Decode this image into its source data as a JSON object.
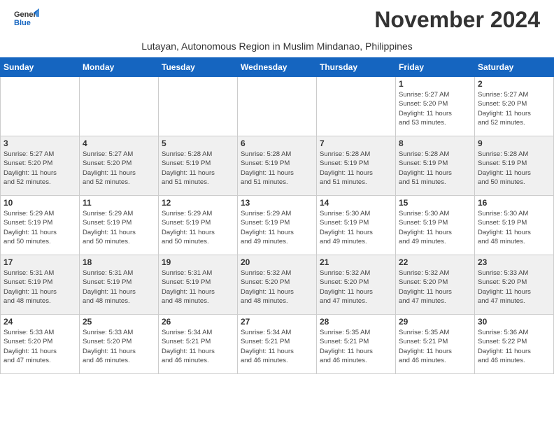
{
  "header": {
    "logo": {
      "text_general": "General",
      "text_blue": "Blue"
    },
    "month_title": "November 2024",
    "subtitle": "Lutayan, Autonomous Region in Muslim Mindanao, Philippines"
  },
  "calendar": {
    "days_of_week": [
      "Sunday",
      "Monday",
      "Tuesday",
      "Wednesday",
      "Thursday",
      "Friday",
      "Saturday"
    ],
    "weeks": [
      {
        "days": [
          {
            "num": "",
            "info": ""
          },
          {
            "num": "",
            "info": ""
          },
          {
            "num": "",
            "info": ""
          },
          {
            "num": "",
            "info": ""
          },
          {
            "num": "",
            "info": ""
          },
          {
            "num": "1",
            "info": "Sunrise: 5:27 AM\nSunset: 5:20 PM\nDaylight: 11 hours\nand 53 minutes."
          },
          {
            "num": "2",
            "info": "Sunrise: 5:27 AM\nSunset: 5:20 PM\nDaylight: 11 hours\nand 52 minutes."
          }
        ]
      },
      {
        "days": [
          {
            "num": "3",
            "info": "Sunrise: 5:27 AM\nSunset: 5:20 PM\nDaylight: 11 hours\nand 52 minutes."
          },
          {
            "num": "4",
            "info": "Sunrise: 5:27 AM\nSunset: 5:20 PM\nDaylight: 11 hours\nand 52 minutes."
          },
          {
            "num": "5",
            "info": "Sunrise: 5:28 AM\nSunset: 5:19 PM\nDaylight: 11 hours\nand 51 minutes."
          },
          {
            "num": "6",
            "info": "Sunrise: 5:28 AM\nSunset: 5:19 PM\nDaylight: 11 hours\nand 51 minutes."
          },
          {
            "num": "7",
            "info": "Sunrise: 5:28 AM\nSunset: 5:19 PM\nDaylight: 11 hours\nand 51 minutes."
          },
          {
            "num": "8",
            "info": "Sunrise: 5:28 AM\nSunset: 5:19 PM\nDaylight: 11 hours\nand 51 minutes."
          },
          {
            "num": "9",
            "info": "Sunrise: 5:28 AM\nSunset: 5:19 PM\nDaylight: 11 hours\nand 50 minutes."
          }
        ]
      },
      {
        "days": [
          {
            "num": "10",
            "info": "Sunrise: 5:29 AM\nSunset: 5:19 PM\nDaylight: 11 hours\nand 50 minutes."
          },
          {
            "num": "11",
            "info": "Sunrise: 5:29 AM\nSunset: 5:19 PM\nDaylight: 11 hours\nand 50 minutes."
          },
          {
            "num": "12",
            "info": "Sunrise: 5:29 AM\nSunset: 5:19 PM\nDaylight: 11 hours\nand 50 minutes."
          },
          {
            "num": "13",
            "info": "Sunrise: 5:29 AM\nSunset: 5:19 PM\nDaylight: 11 hours\nand 49 minutes."
          },
          {
            "num": "14",
            "info": "Sunrise: 5:30 AM\nSunset: 5:19 PM\nDaylight: 11 hours\nand 49 minutes."
          },
          {
            "num": "15",
            "info": "Sunrise: 5:30 AM\nSunset: 5:19 PM\nDaylight: 11 hours\nand 49 minutes."
          },
          {
            "num": "16",
            "info": "Sunrise: 5:30 AM\nSunset: 5:19 PM\nDaylight: 11 hours\nand 48 minutes."
          }
        ]
      },
      {
        "days": [
          {
            "num": "17",
            "info": "Sunrise: 5:31 AM\nSunset: 5:19 PM\nDaylight: 11 hours\nand 48 minutes."
          },
          {
            "num": "18",
            "info": "Sunrise: 5:31 AM\nSunset: 5:19 PM\nDaylight: 11 hours\nand 48 minutes."
          },
          {
            "num": "19",
            "info": "Sunrise: 5:31 AM\nSunset: 5:19 PM\nDaylight: 11 hours\nand 48 minutes."
          },
          {
            "num": "20",
            "info": "Sunrise: 5:32 AM\nSunset: 5:20 PM\nDaylight: 11 hours\nand 48 minutes."
          },
          {
            "num": "21",
            "info": "Sunrise: 5:32 AM\nSunset: 5:20 PM\nDaylight: 11 hours\nand 47 minutes."
          },
          {
            "num": "22",
            "info": "Sunrise: 5:32 AM\nSunset: 5:20 PM\nDaylight: 11 hours\nand 47 minutes."
          },
          {
            "num": "23",
            "info": "Sunrise: 5:33 AM\nSunset: 5:20 PM\nDaylight: 11 hours\nand 47 minutes."
          }
        ]
      },
      {
        "days": [
          {
            "num": "24",
            "info": "Sunrise: 5:33 AM\nSunset: 5:20 PM\nDaylight: 11 hours\nand 47 minutes."
          },
          {
            "num": "25",
            "info": "Sunrise: 5:33 AM\nSunset: 5:20 PM\nDaylight: 11 hours\nand 46 minutes."
          },
          {
            "num": "26",
            "info": "Sunrise: 5:34 AM\nSunset: 5:21 PM\nDaylight: 11 hours\nand 46 minutes."
          },
          {
            "num": "27",
            "info": "Sunrise: 5:34 AM\nSunset: 5:21 PM\nDaylight: 11 hours\nand 46 minutes."
          },
          {
            "num": "28",
            "info": "Sunrise: 5:35 AM\nSunset: 5:21 PM\nDaylight: 11 hours\nand 46 minutes."
          },
          {
            "num": "29",
            "info": "Sunrise: 5:35 AM\nSunset: 5:21 PM\nDaylight: 11 hours\nand 46 minutes."
          },
          {
            "num": "30",
            "info": "Sunrise: 5:36 AM\nSunset: 5:22 PM\nDaylight: 11 hours\nand 46 minutes."
          }
        ]
      }
    ]
  }
}
